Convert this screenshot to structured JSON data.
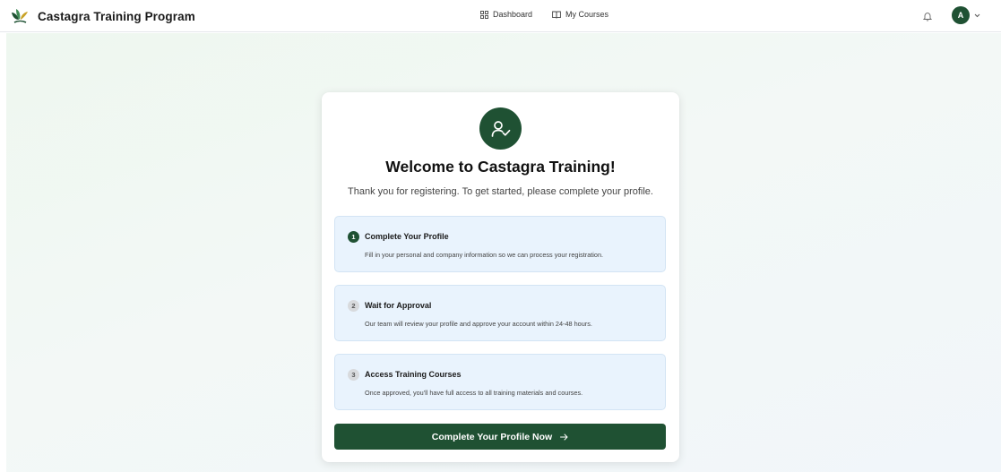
{
  "header": {
    "brand_name": "Castagra Training Program",
    "nav": [
      {
        "label": "Dashboard",
        "icon": "grid-icon"
      },
      {
        "label": "My Courses",
        "icon": "book-icon"
      }
    ],
    "notification_icon": "bell-icon",
    "avatar_initial": "A",
    "avatar_menu_icon": "chevron-down-icon"
  },
  "welcome": {
    "icon": "user-check-icon",
    "title": "Welcome to Castagra Training!",
    "subtitle": "Thank you for registering. To get started, please complete your profile."
  },
  "steps": [
    {
      "number": "1",
      "title": "Complete Your Profile",
      "description": "Fill in your personal and company information so we can process your registration.",
      "active": true
    },
    {
      "number": "2",
      "title": "Wait for Approval",
      "description": "Our team will review your profile and approve your account within 24-48 hours.",
      "active": false
    },
    {
      "number": "3",
      "title": "Access Training Courses",
      "description": "Once approved, you'll have full access to all training materials and courses.",
      "active": false
    }
  ],
  "cta": {
    "label": "Complete Your Profile Now",
    "icon": "arrow-right-icon"
  },
  "colors": {
    "brand_green": "#1f5133",
    "step_bg": "#e9f3fd",
    "page_bg": "#eef7ef"
  }
}
